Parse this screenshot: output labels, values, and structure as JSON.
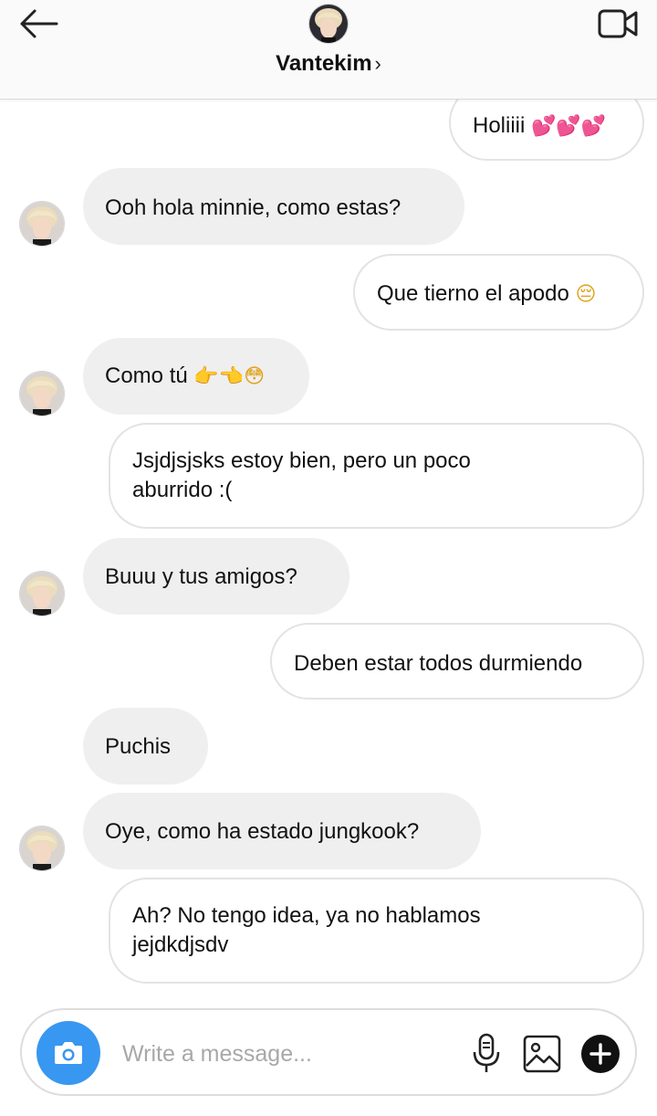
{
  "header": {
    "title": "Vantekim",
    "chevron": "›"
  },
  "messages": [
    {
      "side": "out",
      "text": "Holiiii",
      "emoji": "💕💕💕"
    },
    {
      "side": "in",
      "text": "Ooh hola minnie, como estas?"
    },
    {
      "side": "out",
      "text": "Que tierno el apodo",
      "emoji": "😔"
    },
    {
      "side": "in",
      "text": "Como tú",
      "emoji": "👉👈😳"
    },
    {
      "side": "out",
      "text": "Jsjdjsjsks estoy bien, pero un poco aburrido :("
    },
    {
      "side": "in",
      "text": "Buuu y tus amigos?"
    },
    {
      "side": "out",
      "text": "Deben estar todos durmiendo"
    },
    {
      "side": "in",
      "text": "Puchis"
    },
    {
      "side": "in",
      "text": "Oye, como ha estado jungkook?"
    },
    {
      "side": "out",
      "text": "Ah? No tengo idea, ya no hablamos jejdkdjsdv"
    }
  ],
  "composer": {
    "placeholder": "Write a message..."
  },
  "icons": {
    "back": "arrow-left-icon",
    "video": "video-camera-icon",
    "camera": "camera-icon",
    "mic": "microphone-icon",
    "gallery": "image-icon",
    "add": "plus-circle-icon"
  },
  "colors": {
    "accent": "#3897f0",
    "incoming_bubble": "#efefef",
    "outgoing_border": "#e3e3e3",
    "placeholder": "#a8a8a8"
  }
}
